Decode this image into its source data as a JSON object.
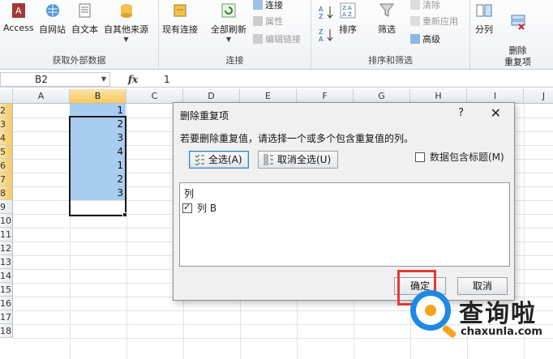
{
  "ribbon": {
    "groups": [
      {
        "label": "获取外部数据",
        "buttons": [
          "Access",
          "自网站",
          "自文本",
          "自其他来源"
        ]
      },
      {
        "label": "连接",
        "buttons": [
          "现有连接",
          "全部刷新"
        ],
        "small": [
          "连接",
          "属性",
          "编辑链接"
        ]
      },
      {
        "label": "排序和筛选",
        "buttons": [
          "排序",
          "筛选"
        ],
        "small": [
          "清除",
          "重新应用",
          "高级"
        ]
      },
      {
        "label": "",
        "buttons": [
          "分列",
          "删除\n重复项"
        ]
      }
    ]
  },
  "formula_bar": {
    "name_box": "B2",
    "fx": "fx",
    "value": "1"
  },
  "grid": {
    "columns": [
      "A",
      "B",
      "C",
      "D",
      "E",
      "F",
      "G",
      "H",
      "I",
      "J"
    ],
    "rows": [
      "2",
      "3",
      "4",
      "5",
      "6",
      "7",
      "8",
      "9",
      "10",
      "11",
      "12",
      "13",
      "14",
      "15",
      "16",
      "17",
      "18"
    ],
    "column_b_values": [
      "1",
      "2",
      "3",
      "4",
      "1",
      "2",
      "3"
    ]
  },
  "dialog": {
    "title": "删除重复项",
    "help": "?",
    "close": "✕",
    "prompt": "若要删除重复值，请选择一个或多个包含重复值的列。",
    "select_all": "全选(A)",
    "unselect_all": "取消全选(U)",
    "has_headers_label": "数据包含标题(M)",
    "has_headers_checked": false,
    "list_header": "列",
    "list_items": [
      {
        "label": "列 B",
        "checked": true
      }
    ],
    "ok": "确定",
    "cancel": "取消"
  },
  "watermark": {
    "cn": "查询啦",
    "en": "chaxunla.com"
  },
  "colors": {
    "selection": "#a9cdf0",
    "header_selected": "#f5c95d",
    "highlight": "#e53935",
    "watermark_blue": "#1e88e5",
    "watermark_orange": "#f7a21b"
  }
}
